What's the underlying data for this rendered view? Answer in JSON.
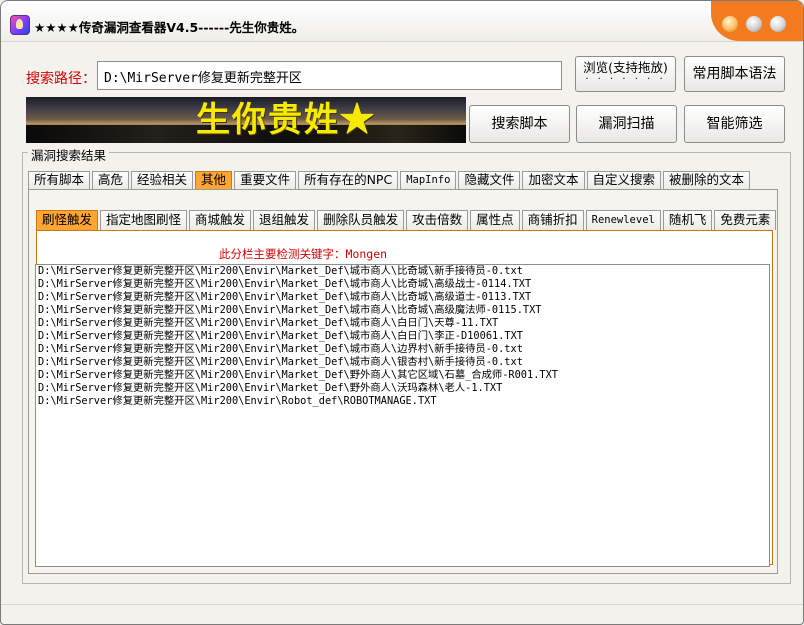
{
  "window": {
    "title": "★★★★传奇漏洞查看器V4.5------先生你贵姓。"
  },
  "path": {
    "label": "搜索路径：",
    "value": "D:\\MirServer修复更新完整开区"
  },
  "buttons": {
    "browse_label": "浏览(支持拖放)",
    "browse_dots": "· · · · · · ·",
    "syntax_label": "常用脚本语法",
    "search_label": "搜索脚本",
    "scan_label": "漏洞扫描",
    "filter_label": "智能筛选"
  },
  "banner": {
    "text": "生你贵姓★"
  },
  "results_group": {
    "title": "漏洞搜索结果"
  },
  "main_tabs": [
    {
      "label": "所有脚本"
    },
    {
      "label": "高危"
    },
    {
      "label": "经验相关"
    },
    {
      "label": "其他"
    },
    {
      "label": "重要文件"
    },
    {
      "label": "所有存在的NPC"
    },
    {
      "label": "MapInfo"
    },
    {
      "label": "隐藏文件"
    },
    {
      "label": "加密文本"
    },
    {
      "label": "自定义搜索"
    },
    {
      "label": "被删除的文本"
    }
  ],
  "sub_tabs": [
    {
      "label": "刷怪触发"
    },
    {
      "label": "指定地图刷怪"
    },
    {
      "label": "商城触发"
    },
    {
      "label": "退组触发"
    },
    {
      "label": "删除队员触发"
    },
    {
      "label": "攻击倍数"
    },
    {
      "label": "属性点"
    },
    {
      "label": "商铺折扣"
    },
    {
      "label": "Renewlevel"
    },
    {
      "label": "随机飞"
    },
    {
      "label": "免费元素"
    }
  ],
  "keyword_hint": "此分栏主要检测关键字：Mongen",
  "results": [
    "D:\\MirServer修复更新完整开区\\Mir200\\Envir\\Market_Def\\城市商人\\比奇城\\新手接待员-0.txt",
    "D:\\MirServer修复更新完整开区\\Mir200\\Envir\\Market_Def\\城市商人\\比奇城\\高级战士-0114.TXT",
    "D:\\MirServer修复更新完整开区\\Mir200\\Envir\\Market_Def\\城市商人\\比奇城\\高级道士-0113.TXT",
    "D:\\MirServer修复更新完整开区\\Mir200\\Envir\\Market_Def\\城市商人\\比奇城\\高级魔法师-0115.TXT",
    "D:\\MirServer修复更新完整开区\\Mir200\\Envir\\Market_Def\\城市商人\\白日门\\天尊-11.TXT",
    "D:\\MirServer修复更新完整开区\\Mir200\\Envir\\Market_Def\\城市商人\\白日门\\李正-D10061.TXT",
    "D:\\MirServer修复更新完整开区\\Mir200\\Envir\\Market_Def\\城市商人\\边界村\\新手接待员-0.txt",
    "D:\\MirServer修复更新完整开区\\Mir200\\Envir\\Market_Def\\城市商人\\银杏村\\新手接待员-0.txt",
    "D:\\MirServer修复更新完整开区\\Mir200\\Envir\\Market_Def\\野外商人\\其它区域\\石墓_合成师-R001.TXT",
    "D:\\MirServer修复更新完整开区\\Mir200\\Envir\\Market_Def\\野外商人\\沃玛森林\\老人-1.TXT",
    "D:\\MirServer修复更新完整开区\\Mir200\\Envir\\Robot_def\\ROBOTMANAGE.TXT"
  ],
  "colors": {
    "accent_tab": "#ffa531",
    "titlebar_buttons_bg": "#f47a1f",
    "label_red": "#d40000",
    "banner_text": "#f6ea00"
  }
}
